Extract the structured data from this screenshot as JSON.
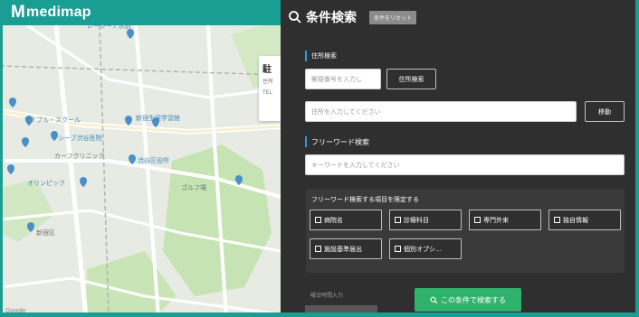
{
  "app": {
    "logo_mark": "M",
    "logo_text": "medimap"
  },
  "map": {
    "pois": [
      {
        "label": "レーシーア水前",
        "color": "blue"
      },
      {
        "label": "マナブル・スクール",
        "color": "blue"
      },
      {
        "label": "新宿生涯学習館",
        "color": "blue"
      },
      {
        "label": "シーブ渋谷医院",
        "color": "blue"
      },
      {
        "label": "渋谷区役所",
        "color": "blue"
      },
      {
        "label": "カーフクリニック",
        "color": "gray"
      },
      {
        "label": "オリンピック",
        "color": "blue"
      },
      {
        "label": "ゴルフ場",
        "color": "gray"
      },
      {
        "label": "新宿区",
        "color": "gray"
      }
    ],
    "card_title": "駐",
    "card_lines": [
      "住所",
      "TEL"
    ],
    "attribution": "Google"
  },
  "panel": {
    "title": "条件検索",
    "reset_label": "条件をリセット",
    "address": {
      "heading": "住所検索",
      "postal_placeholder": "郵便番号を入力し",
      "postal_button": "住所検索",
      "address_placeholder": "住所を入力してください",
      "move_button": "移動"
    },
    "freeword": {
      "heading": "フリーワード検索",
      "placeholder": "キーワードを入力してください",
      "limit_label": "フリーワード検索する項目を限定する",
      "options": [
        "病院名",
        "診療科目",
        "専門外来",
        "独自情報",
        "施設基準届出",
        "個別オプシ…"
      ]
    },
    "hours_label": "曜日時間入力",
    "submit_label": "この条件で検索する"
  },
  "colors": {
    "brand_teal": "#1a9d92",
    "panel_bg": "#2f2f2f",
    "accent_blue": "#2b9ae0",
    "submit_green": "#2fb26b"
  }
}
